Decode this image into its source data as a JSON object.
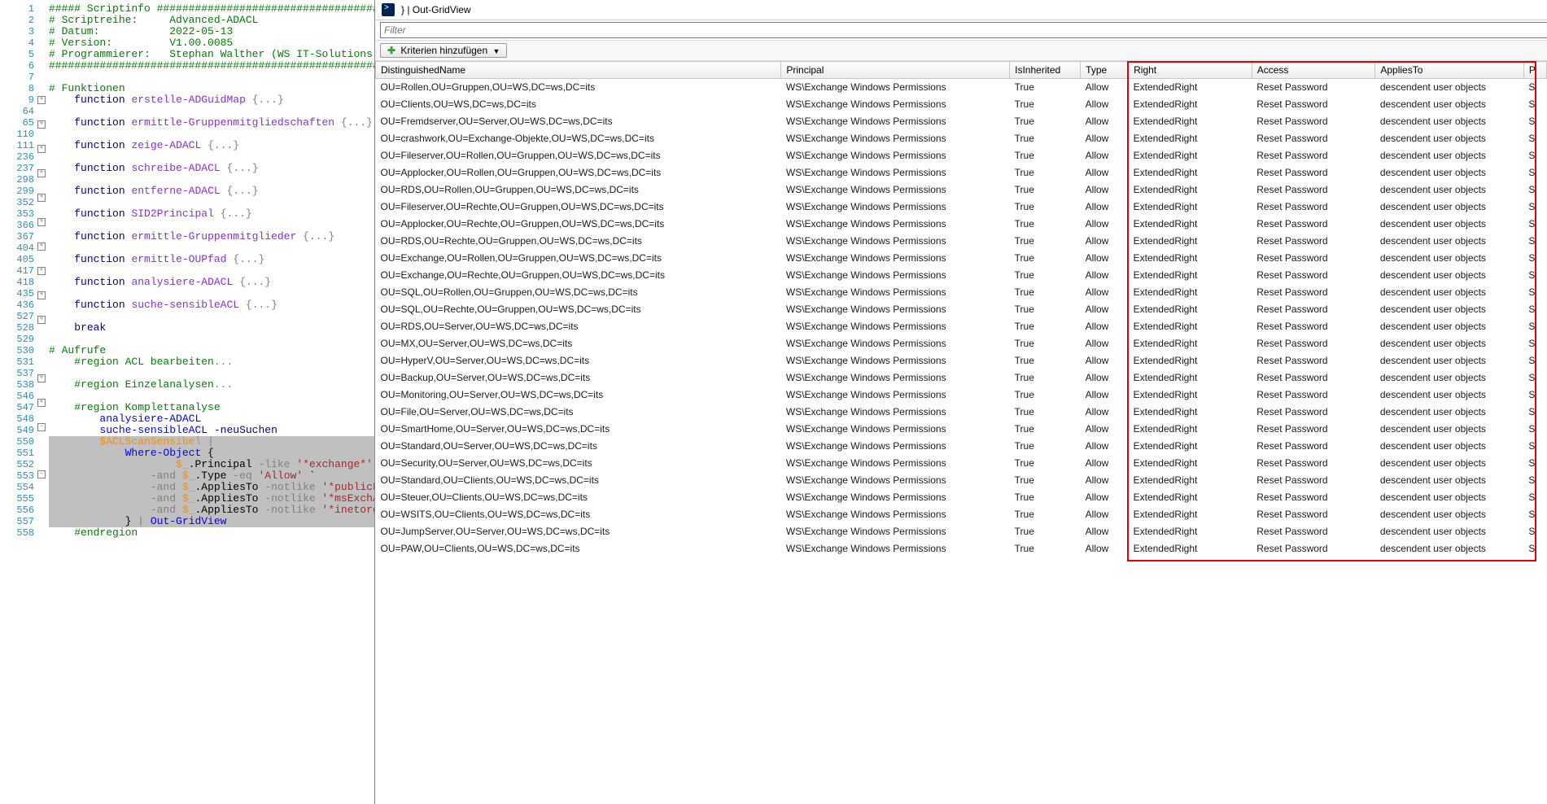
{
  "editor": {
    "lines": [
      {
        "n": 1,
        "fold": "",
        "html": "<span class='c-green'>##### Scriptinfo ###########################################################################</span>"
      },
      {
        "n": 2,
        "fold": "",
        "html": "<span class='c-green'># Scriptreihe:&nbsp;&nbsp;&nbsp;&nbsp;&nbsp;Advanced-ADACL</span>"
      },
      {
        "n": 3,
        "fold": "",
        "html": "<span class='c-green'># Datum:&nbsp;&nbsp;&nbsp;&nbsp;&nbsp;&nbsp;&nbsp;&nbsp;&nbsp;&nbsp;&nbsp;2022-05-13</span>"
      },
      {
        "n": 4,
        "fold": "",
        "html": "<span class='c-green'># Version:&nbsp;&nbsp;&nbsp;&nbsp;&nbsp;&nbsp;&nbsp;&nbsp;&nbsp;V1.00.0085</span>"
      },
      {
        "n": 5,
        "fold": "",
        "html": "<span class='c-green'># Programmierer:&nbsp;&nbsp;&nbsp;Stephan Walther (WS IT-Solutions)</span>"
      },
      {
        "n": 6,
        "fold": "",
        "html": "<span class='c-green'>############################################################################################</span>"
      },
      {
        "n": 7,
        "fold": "",
        "html": ""
      },
      {
        "n": 8,
        "fold": "",
        "html": "<span class='c-green'># Funktionen</span>"
      },
      {
        "n": 9,
        "fold": "+",
        "html": "&nbsp;&nbsp;&nbsp;&nbsp;<span class='c-navy'>function</span> <span class='c-purple'>erstelle-ADGuidMap</span> <span class='c-gray'>{...}</span>"
      },
      {
        "n": 64,
        "fold": "",
        "html": ""
      },
      {
        "n": 65,
        "fold": "+",
        "html": "&nbsp;&nbsp;&nbsp;&nbsp;<span class='c-navy'>function</span> <span class='c-purple'>ermittle-Gruppenmitgliedschaften</span> <span class='c-gray'>{...}</span>"
      },
      {
        "n": 110,
        "fold": "",
        "html": ""
      },
      {
        "n": 111,
        "fold": "+",
        "html": "&nbsp;&nbsp;&nbsp;&nbsp;<span class='c-navy'>function</span> <span class='c-purple'>zeige-ADACL</span> <span class='c-gray'>{...}</span>"
      },
      {
        "n": 236,
        "fold": "",
        "html": ""
      },
      {
        "n": 237,
        "fold": "+",
        "html": "&nbsp;&nbsp;&nbsp;&nbsp;<span class='c-navy'>function</span> <span class='c-purple'>schreibe-ADACL</span> <span class='c-gray'>{...}</span>"
      },
      {
        "n": 298,
        "fold": "",
        "html": ""
      },
      {
        "n": 299,
        "fold": "+",
        "html": "&nbsp;&nbsp;&nbsp;&nbsp;<span class='c-navy'>function</span> <span class='c-purple'>entferne-ADACL</span> <span class='c-gray'>{...}</span>"
      },
      {
        "n": 352,
        "fold": "",
        "html": ""
      },
      {
        "n": 353,
        "fold": "+",
        "html": "&nbsp;&nbsp;&nbsp;&nbsp;<span class='c-navy'>function</span> <span class='c-purple'>SID2Principal</span> <span class='c-gray'>{...}</span>"
      },
      {
        "n": 366,
        "fold": "",
        "html": ""
      },
      {
        "n": 367,
        "fold": "+",
        "html": "&nbsp;&nbsp;&nbsp;&nbsp;<span class='c-navy'>function</span> <span class='c-purple'>ermittle-Gruppenmitglieder</span> <span class='c-gray'>{...}</span>"
      },
      {
        "n": 404,
        "fold": "",
        "html": ""
      },
      {
        "n": 405,
        "fold": "+",
        "html": "&nbsp;&nbsp;&nbsp;&nbsp;<span class='c-navy'>function</span> <span class='c-purple'>ermittle-OUPfad</span> <span class='c-gray'>{...}</span>"
      },
      {
        "n": 417,
        "fold": "",
        "html": ""
      },
      {
        "n": 418,
        "fold": "+",
        "html": "&nbsp;&nbsp;&nbsp;&nbsp;<span class='c-navy'>function</span> <span class='c-purple'>analysiere-ADACL</span> <span class='c-gray'>{...}</span>"
      },
      {
        "n": 435,
        "fold": "",
        "html": ""
      },
      {
        "n": 436,
        "fold": "+",
        "html": "&nbsp;&nbsp;&nbsp;&nbsp;<span class='c-navy'>function</span> <span class='c-purple'>suche-sensibleACL</span> <span class='c-gray'>{...}</span>"
      },
      {
        "n": 527,
        "fold": "",
        "html": ""
      },
      {
        "n": 528,
        "fold": "",
        "html": "&nbsp;&nbsp;&nbsp;&nbsp;<span class='c-navy'>break</span>"
      },
      {
        "n": 529,
        "fold": "",
        "html": ""
      },
      {
        "n": 530,
        "fold": "",
        "html": "<span class='c-green'># Aufrufe</span>"
      },
      {
        "n": 531,
        "fold": "+",
        "html": "&nbsp;&nbsp;&nbsp;&nbsp;<span class='c-green'>#region ACL bearbeiten</span><span class='c-gray'>...</span>"
      },
      {
        "n": 537,
        "fold": "",
        "html": ""
      },
      {
        "n": 538,
        "fold": "+",
        "html": "&nbsp;&nbsp;&nbsp;&nbsp;<span class='c-green'>#region Einzelanalysen</span><span class='c-gray'>...</span>"
      },
      {
        "n": 546,
        "fold": "",
        "html": ""
      },
      {
        "n": 547,
        "fold": "-",
        "html": "&nbsp;&nbsp;&nbsp;&nbsp;<span class='c-green'>#region Komplettanalyse</span>"
      },
      {
        "n": 548,
        "fold": "",
        "html": "&nbsp;&nbsp;&nbsp;&nbsp;&nbsp;&nbsp;&nbsp;&nbsp;<span class='c-blue'>analysiere-ADACL</span>"
      },
      {
        "n": 549,
        "fold": "",
        "html": "&nbsp;&nbsp;&nbsp;&nbsp;&nbsp;&nbsp;&nbsp;&nbsp;<span class='c-blue'>suche-sensibleACL</span> <span class='c-navy'>-neuSuchen</span>"
      },
      {
        "n": 550,
        "fold": "",
        "sel": true,
        "html": "&nbsp;&nbsp;&nbsp;&nbsp;&nbsp;&nbsp;&nbsp;&nbsp;<span class='c-orange'>$ACLScanSensibel</span> <span class='c-gray'>|</span>"
      },
      {
        "n": 551,
        "fold": "-",
        "sel": true,
        "html": "&nbsp;&nbsp;&nbsp;&nbsp;&nbsp;&nbsp;&nbsp;&nbsp;&nbsp;&nbsp;&nbsp;&nbsp;<span class='c-blue'>Where-Object</span> {"
      },
      {
        "n": 552,
        "fold": "",
        "sel": true,
        "html": "&nbsp;&nbsp;&nbsp;&nbsp;&nbsp;&nbsp;&nbsp;&nbsp;&nbsp;&nbsp;&nbsp;&nbsp;&nbsp;&nbsp;&nbsp;&nbsp;&nbsp;&nbsp;&nbsp;&nbsp;<span class='c-orange'>$_</span>.Principal <span class='c-gray'>-like</span> <span class='c-brown'>'*exchange*'</span> `"
      },
      {
        "n": 553,
        "fold": "",
        "sel": true,
        "html": "&nbsp;&nbsp;&nbsp;&nbsp;&nbsp;&nbsp;&nbsp;&nbsp;&nbsp;&nbsp;&nbsp;&nbsp;&nbsp;&nbsp;&nbsp;&nbsp;<span class='c-gray'>-and</span> <span class='c-orange'>$_</span>.Type <span class='c-gray'>-eq</span> <span class='c-brown'>'Allow'</span> `"
      },
      {
        "n": 554,
        "fold": "",
        "sel": true,
        "html": "&nbsp;&nbsp;&nbsp;&nbsp;&nbsp;&nbsp;&nbsp;&nbsp;&nbsp;&nbsp;&nbsp;&nbsp;&nbsp;&nbsp;&nbsp;&nbsp;<span class='c-gray'>-and</span> <span class='c-orange'>$_</span>.AppliesTo <span class='c-gray'>-notlike</span> <span class='c-brown'>'*publicF</span>"
      },
      {
        "n": 555,
        "fold": "",
        "sel": true,
        "html": "&nbsp;&nbsp;&nbsp;&nbsp;&nbsp;&nbsp;&nbsp;&nbsp;&nbsp;&nbsp;&nbsp;&nbsp;&nbsp;&nbsp;&nbsp;&nbsp;<span class='c-gray'>-and</span> <span class='c-orange'>$_</span>.AppliesTo <span class='c-gray'>-notlike</span> <span class='c-brown'>'*msExchA</span>"
      },
      {
        "n": 556,
        "fold": "",
        "sel": true,
        "html": "&nbsp;&nbsp;&nbsp;&nbsp;&nbsp;&nbsp;&nbsp;&nbsp;&nbsp;&nbsp;&nbsp;&nbsp;&nbsp;&nbsp;&nbsp;&nbsp;<span class='c-gray'>-and</span> <span class='c-orange'>$_</span>.AppliesTo <span class='c-gray'>-notlike</span> <span class='c-brown'>'*inetorg</span>"
      },
      {
        "n": 557,
        "fold": "",
        "sel": true,
        "html": "&nbsp;&nbsp;&nbsp;&nbsp;&nbsp;&nbsp;&nbsp;&nbsp;&nbsp;&nbsp;&nbsp;&nbsp;} <span class='c-gray'>|</span> <span class='c-blue'>Out-GridView</span>"
      },
      {
        "n": 558,
        "fold": "",
        "html": "&nbsp;&nbsp;&nbsp;&nbsp;<span class='c-green'>#endregion</span>"
      }
    ]
  },
  "ogv": {
    "title": "} | Out-GridView",
    "filter_placeholder": "Filter",
    "criteria_label": "Kriterien hinzufügen",
    "columns": [
      "DistinguishedName",
      "Principal",
      "IsInherited",
      "Type",
      "Right",
      "Access",
      "AppliesTo",
      "P"
    ],
    "common": {
      "principal": "WS\\Exchange Windows Permissions",
      "inherited": "True",
      "type": "Allow",
      "right": "ExtendedRight",
      "access": "Reset Password",
      "applies": "descendent user objects",
      "extra": "S"
    },
    "rows": [
      "OU=Rollen,OU=Gruppen,OU=WS,DC=ws,DC=its",
      "OU=Clients,OU=WS,DC=ws,DC=its",
      "OU=Fremdserver,OU=Server,OU=WS,DC=ws,DC=its",
      "OU=crashwork,OU=Exchange-Objekte,OU=WS,DC=ws,DC=its",
      "OU=Fileserver,OU=Rollen,OU=Gruppen,OU=WS,DC=ws,DC=its",
      "OU=Applocker,OU=Rollen,OU=Gruppen,OU=WS,DC=ws,DC=its",
      "OU=RDS,OU=Rollen,OU=Gruppen,OU=WS,DC=ws,DC=its",
      "OU=Fileserver,OU=Rechte,OU=Gruppen,OU=WS,DC=ws,DC=its",
      "OU=Applocker,OU=Rechte,OU=Gruppen,OU=WS,DC=ws,DC=its",
      "OU=RDS,OU=Rechte,OU=Gruppen,OU=WS,DC=ws,DC=its",
      "OU=Exchange,OU=Rollen,OU=Gruppen,OU=WS,DC=ws,DC=its",
      "OU=Exchange,OU=Rechte,OU=Gruppen,OU=WS,DC=ws,DC=its",
      "OU=SQL,OU=Rollen,OU=Gruppen,OU=WS,DC=ws,DC=its",
      "OU=SQL,OU=Rechte,OU=Gruppen,OU=WS,DC=ws,DC=its",
      "OU=RDS,OU=Server,OU=WS,DC=ws,DC=its",
      "OU=MX,OU=Server,OU=WS,DC=ws,DC=its",
      "OU=HyperV,OU=Server,OU=WS,DC=ws,DC=its",
      "OU=Backup,OU=Server,OU=WS,DC=ws,DC=its",
      "OU=Monitoring,OU=Server,OU=WS,DC=ws,DC=its",
      "OU=File,OU=Server,OU=WS,DC=ws,DC=its",
      "OU=SmartHome,OU=Server,OU=WS,DC=ws,DC=its",
      "OU=Standard,OU=Server,OU=WS,DC=ws,DC=its",
      "OU=Security,OU=Server,OU=WS,DC=ws,DC=its",
      "OU=Standard,OU=Clients,OU=WS,DC=ws,DC=its",
      "OU=Steuer,OU=Clients,OU=WS,DC=ws,DC=its",
      "OU=WSITS,OU=Clients,OU=WS,DC=ws,DC=its",
      "OU=JumpServer,OU=Server,OU=WS,DC=ws,DC=its",
      "OU=PAW,OU=Clients,OU=WS,DC=ws,DC=its"
    ]
  }
}
